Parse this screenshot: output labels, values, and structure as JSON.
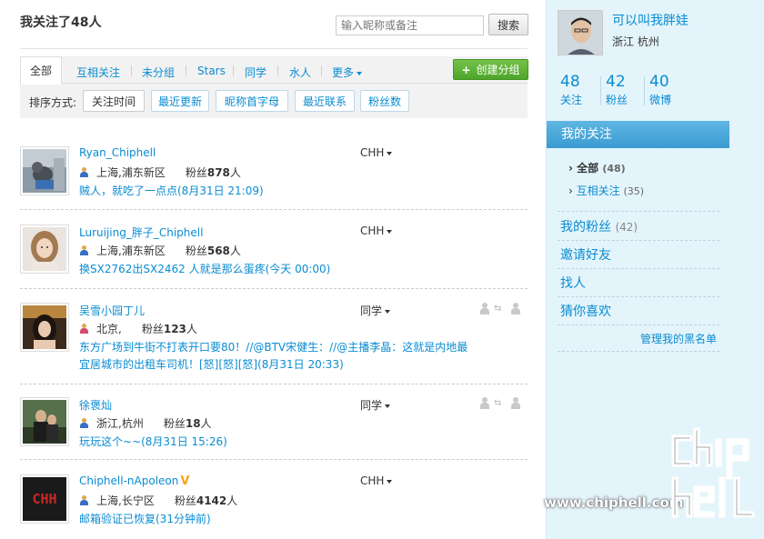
{
  "header": {
    "title": "我关注了48人",
    "search_placeholder": "输入昵称或备注",
    "search_button": "搜索"
  },
  "tabs": {
    "items": [
      "全部",
      "互相关注",
      "未分组",
      "Stars",
      "同学",
      "水人",
      "更多"
    ],
    "active": "全部",
    "create_group": "创建分组"
  },
  "sort": {
    "label": "排序方式:",
    "options": [
      "关注时间",
      "最近更新",
      "昵称首字母",
      "最近联系",
      "粉丝数"
    ],
    "active": "关注时间"
  },
  "follows": [
    {
      "name": "Ryan_Chiphell",
      "gender": "male",
      "location": "上海,浦东新区",
      "fans_label": "粉丝",
      "fans": "878",
      "fans_suffix": "人",
      "status": "贼人，就吃了一点点(8月31日 21:09)",
      "group": "CHH"
    },
    {
      "name": "Luruijing_胖子_Chiphell",
      "gender": "male",
      "location": "上海,浦东新区",
      "fans_label": "粉丝",
      "fans": "568",
      "fans_suffix": "人",
      "status": "换SX2762出SX2462 人就是那么蛋疼(今天 00:00)",
      "group": "CHH"
    },
    {
      "name": "吴雪小园丁儿",
      "gender": "female",
      "location": "北京,",
      "fans_label": "粉丝",
      "fans": "123",
      "fans_suffix": "人",
      "status": "东方广场到牛街不打表开口要80！//@BTV宋健生：//@主播李晶：这就是内地最宜居城市的出租车司机！[怒][怒][怒](8月31日 20:33)",
      "group": "同学",
      "mutual": true
    },
    {
      "name": "徐褒灿",
      "gender": "male",
      "location": "浙江,杭州",
      "fans_label": "粉丝",
      "fans": "18",
      "fans_suffix": "人",
      "status": "玩玩这个~~(8月31日 15:26)",
      "group": "同学",
      "mutual": true
    },
    {
      "name": "Chiphell-nApoleon",
      "gender": "male",
      "verified": "V",
      "location": "上海,长宁区",
      "fans_label": "粉丝",
      "fans": "4142",
      "fans_suffix": "人",
      "status": "邮箱验证已恢复(31分钟前)",
      "group": "CHH",
      "avatar_text": "CHH"
    }
  ],
  "sidebar": {
    "profile_name": "可以叫我胖娃",
    "profile_location": "浙江  杭州",
    "stats": [
      {
        "num": "48",
        "label": "关注"
      },
      {
        "num": "42",
        "label": "粉丝"
      },
      {
        "num": "40",
        "label": "微博"
      }
    ],
    "my_follow": "我的关注",
    "sub_all": "全部",
    "sub_all_count": "(48)",
    "sub_mutual": "互相关注",
    "sub_mutual_count": "(35)",
    "my_fans": "我的粉丝",
    "my_fans_count": "(42)",
    "invite": "邀请好友",
    "find": "找人",
    "guess": "猜你喜欢",
    "blacklist": "管理我的黑名单"
  },
  "watermark": {
    "url": "www.chiphell.com",
    "logo": "chip hell"
  },
  "colors": {
    "link": "#0a8cd2",
    "sidebar_bg": "#e4f4fb",
    "active_nav": "#3a9bd2",
    "create_green": "#4ea52a"
  }
}
